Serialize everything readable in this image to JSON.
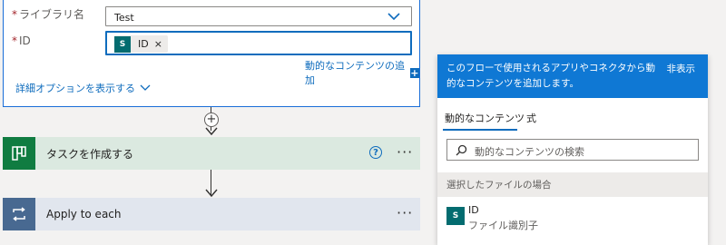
{
  "card": {
    "library_label": "ライブラリ名",
    "library_required": "*",
    "library_value": "Test",
    "id_label": "ID",
    "id_required": "*",
    "id_token_icon": "S",
    "id_token_label": "ID",
    "id_token_remove": "×",
    "add_dynamic_link": "動的なコンテンツの追加",
    "add_dynamic_plus": "+",
    "advanced_options": "詳細オプションを表示する"
  },
  "flow": {
    "insert_step": "+"
  },
  "actions": [
    {
      "title": "タスクを作成する",
      "help": "?",
      "more": "···",
      "color": "#107c41",
      "bar_color": "#dbe9e0",
      "icon": "planner-icon"
    },
    {
      "title": "Apply to each",
      "more": "···",
      "color": "#486991",
      "bar_color": "#e1e6ee",
      "icon": "loop-icon"
    }
  ],
  "pane": {
    "header_text": "このフローで使用されるアプリやコネクタから動的なコンテンツを追加します。",
    "hide": "非表示",
    "tabs": [
      "動的なコンテンツ",
      "式"
    ],
    "active_tab": 0,
    "search_placeholder": "動的なコンテンツの検索",
    "section": "選択したファイルの場合",
    "item": {
      "icon": "S",
      "title": "ID",
      "subtitle": "ファイル識別子"
    }
  },
  "colors": {
    "accent": "#0f6cbd",
    "pane_header": "#0f78d4",
    "sharepoint": "#036c70"
  }
}
